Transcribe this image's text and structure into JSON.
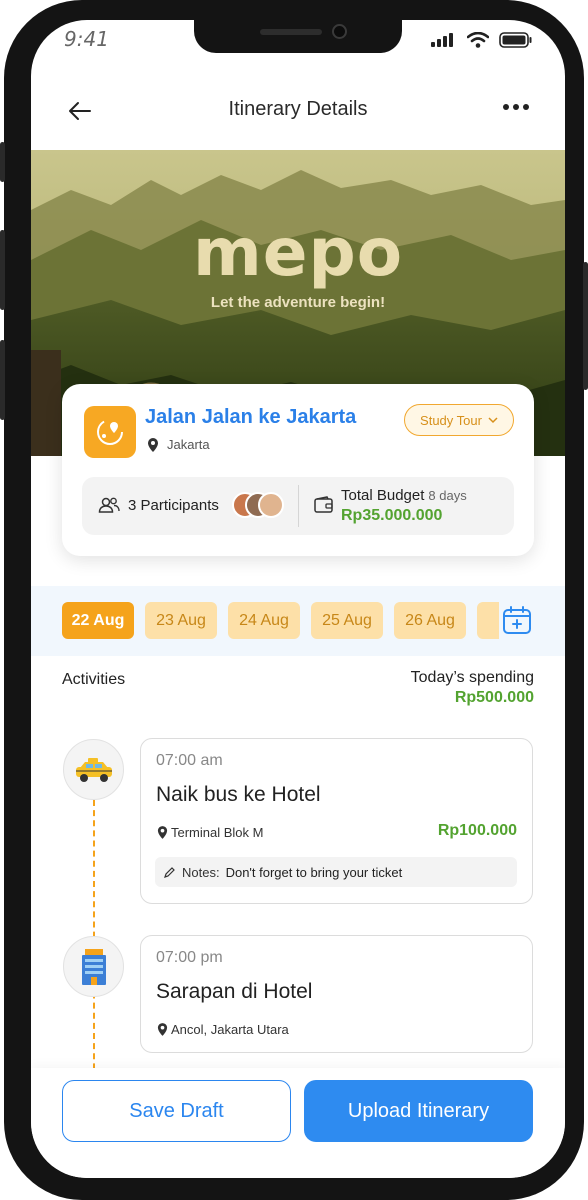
{
  "status": {
    "time": "9:41"
  },
  "header": {
    "title": "Itinerary Details"
  },
  "banner": {
    "logo": "mepo",
    "tagline": "Let the adventure begin!"
  },
  "trip": {
    "title": "Jalan Jalan ke Jakarta",
    "location": "Jakarta",
    "category": "Study Tour",
    "participants": "3 Participants",
    "budget_label": "Total Budget",
    "budget_days": "8 days",
    "budget_value": "Rp35.000.000"
  },
  "dates": [
    "22 Aug",
    "23 Aug",
    "24 Aug",
    "25 Aug",
    "26 Aug"
  ],
  "selected_date": "22 Aug",
  "activities_section": {
    "label": "Activities",
    "spending_label": "Today’s spending",
    "spending_value": "Rp500.000"
  },
  "activities": [
    {
      "time": "07:00 am",
      "title": "Naik bus ke Hotel",
      "location": "Terminal Blok M",
      "price": "Rp100.000",
      "notes_label": "Notes:",
      "notes": "Don't forget to bring your ticket",
      "icon": "taxi-icon"
    },
    {
      "time": "07:00 pm",
      "title": "Sarapan di Hotel",
      "location": "Ancol, Jakarta Utara",
      "icon": "hotel-icon"
    }
  ],
  "actions": {
    "save_draft": "Save Draft",
    "upload": "Upload Itinerary"
  },
  "colors": {
    "primary": "#2e8bf0",
    "accent": "#f5a31b",
    "money": "#53a330"
  }
}
